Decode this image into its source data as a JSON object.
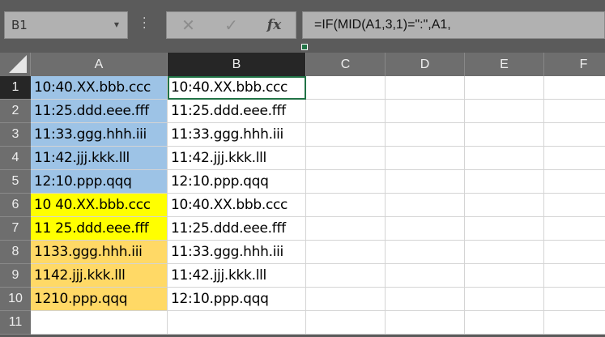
{
  "name_box": "B1",
  "formula_buttons": {
    "cancel": "✕",
    "enter": "✓",
    "fx": "fx"
  },
  "formula": "=IF(MID(A1,3,1)=\":\",A1,",
  "columns": [
    "A",
    "B",
    "C",
    "D",
    "E",
    "F"
  ],
  "rows": [
    "1",
    "2",
    "3",
    "4",
    "5",
    "6",
    "7",
    "8",
    "9",
    "10",
    "11"
  ],
  "colA": [
    "10:40.XX.bbb.ccc",
    "11:25.ddd.eee.fff",
    "11:33.ggg.hhh.iii",
    "11:42.jjj.kkk.lll",
    "12:10.ppp.qqq",
    "10 40.XX.bbb.ccc",
    "11 25.ddd.eee.fff",
    "1133.ggg.hhh.iii",
    "1142.jjj.kkk.lll",
    "1210.ppp.qqq",
    ""
  ],
  "colB": [
    "10:40.XX.bbb.ccc",
    "11:25.ddd.eee.fff",
    "11:33.ggg.hhh.iii",
    "11:42.jjj.kkk.lll",
    "12:10.ppp.qqq",
    "10:40.XX.bbb.ccc",
    "11:25.ddd.eee.fff",
    "11:33.ggg.hhh.iii",
    "11:42.jjj.kkk.lll",
    "12:10.ppp.qqq",
    ""
  ],
  "fill_colors": {
    "blue": "#9dc3e6",
    "yellow": "#ffff00",
    "orange": "#ffd966",
    "selection": "#217346"
  }
}
